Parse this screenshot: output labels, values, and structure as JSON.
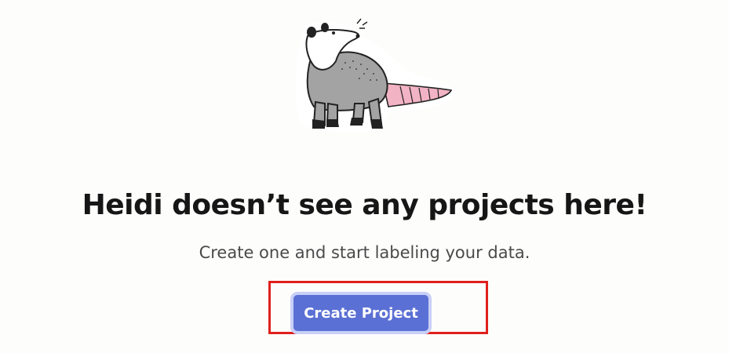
{
  "empty_state": {
    "illustration": "opossum-mascot-icon",
    "title": "Heidi doesn’t see any projects here!",
    "subtitle": "Create one and start labeling your data.",
    "create_button_label": "Create Project"
  },
  "colors": {
    "background": "#fdfdfc",
    "button": "#5b70d4",
    "button_ring": "#c9d0f7",
    "highlight": "#e0201c"
  }
}
